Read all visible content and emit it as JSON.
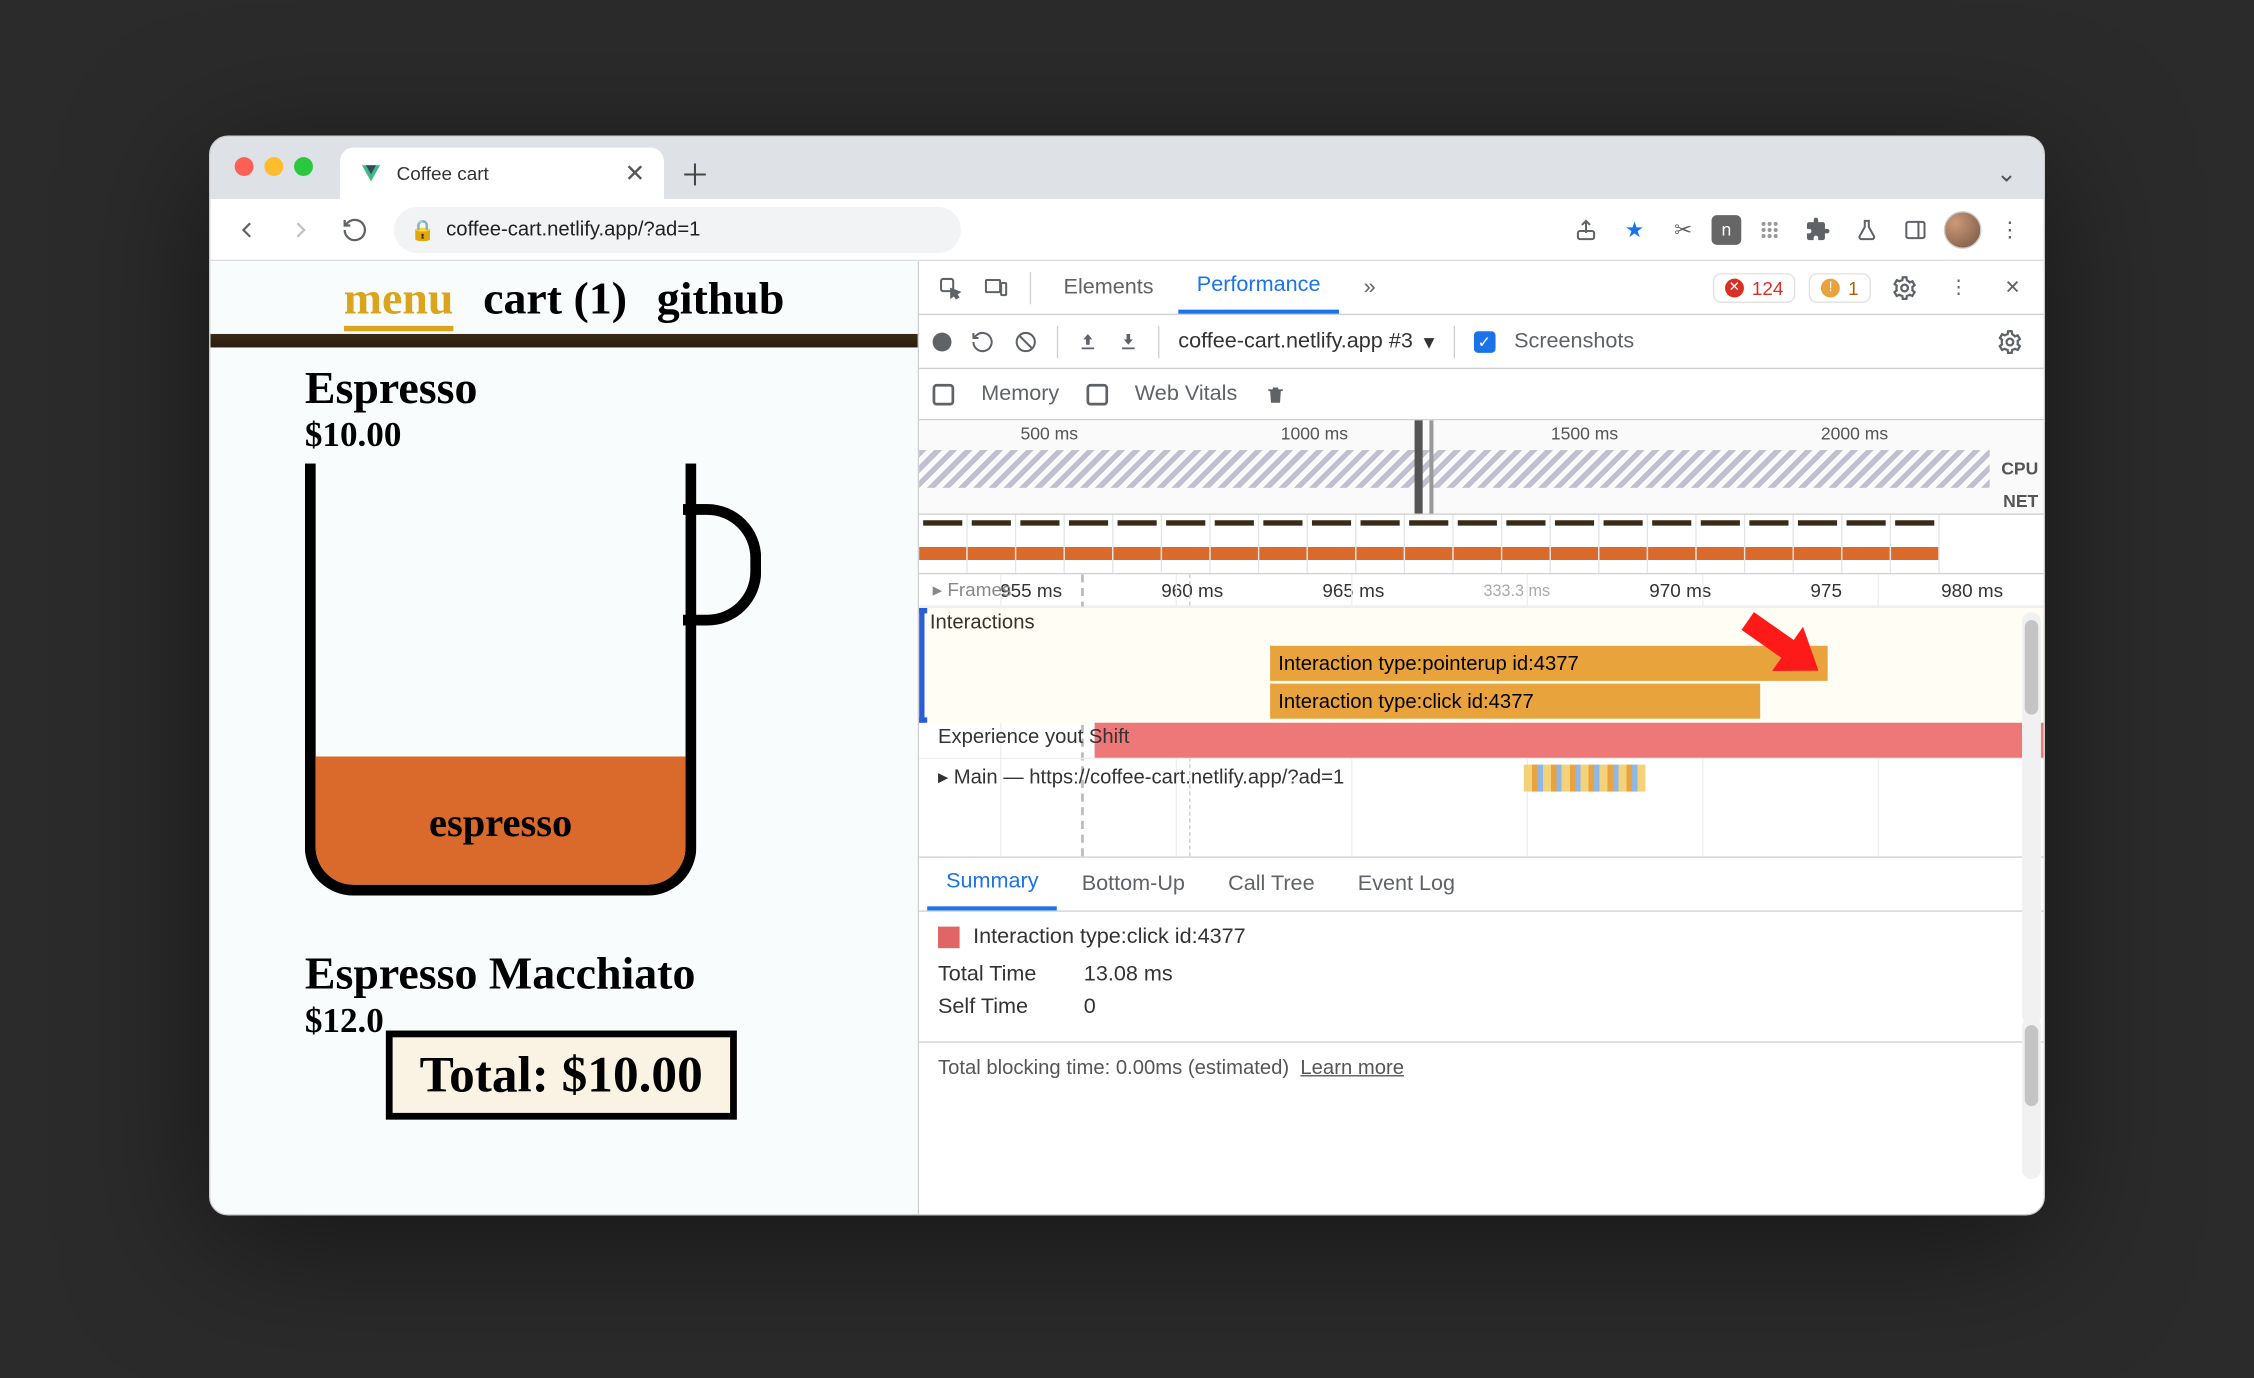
{
  "window": {
    "tab_title": "Coffee cart",
    "url_display": "coffee-cart.netlify.app/?ad=1"
  },
  "page": {
    "nav": {
      "menu": "menu",
      "cart": "cart (1)",
      "github": "github"
    },
    "product1": {
      "name": "Espresso",
      "price": "$10.00",
      "cup_label": "espresso"
    },
    "product2": {
      "name": "Espresso Macchiato",
      "price": "$12.0"
    },
    "total_chip": "Total: $10.00"
  },
  "devtools": {
    "tabs": {
      "elements": "Elements",
      "performance": "Performance",
      "more": "»"
    },
    "counts": {
      "errors": "124",
      "warnings": "1"
    },
    "recording_select": "coffee-cart.netlify.app #3",
    "screenshots_label": "Screenshots",
    "row3": {
      "memory": "Memory",
      "webvitals": "Web Vitals"
    },
    "overview_ticks": [
      "500 ms",
      "1000 ms",
      "1500 ms",
      "2000 ms"
    ],
    "overview_labels": {
      "cpu": "CPU",
      "net": "NET"
    },
    "timeline_ticks": [
      "955 ms",
      "960 ms",
      "965 ms",
      "970 ms",
      "975",
      "980 ms"
    ],
    "timeline_fps_hint": "333.3 ms",
    "tracks": {
      "frames": "Frames",
      "interactions": "Interactions",
      "experience": "Experience",
      "experience_bar": "yout Shift",
      "main": "Main — https://coffee-cart.netlify.app/?ad=1"
    },
    "interactions": {
      "bar1": "Interaction type:pointerup id:4377",
      "bar2": "Interaction type:click id:4377"
    },
    "bottom_tabs": {
      "summary": "Summary",
      "bottomup": "Bottom-Up",
      "calltree": "Call Tree",
      "eventlog": "Event Log"
    },
    "summary": {
      "title": "Interaction type:click id:4377",
      "total_time_k": "Total Time",
      "total_time_v": "13.08 ms",
      "self_time_k": "Self Time",
      "self_time_v": "0"
    },
    "footer": {
      "text": "Total blocking time: 0.00ms (estimated)",
      "link": "Learn more"
    }
  }
}
